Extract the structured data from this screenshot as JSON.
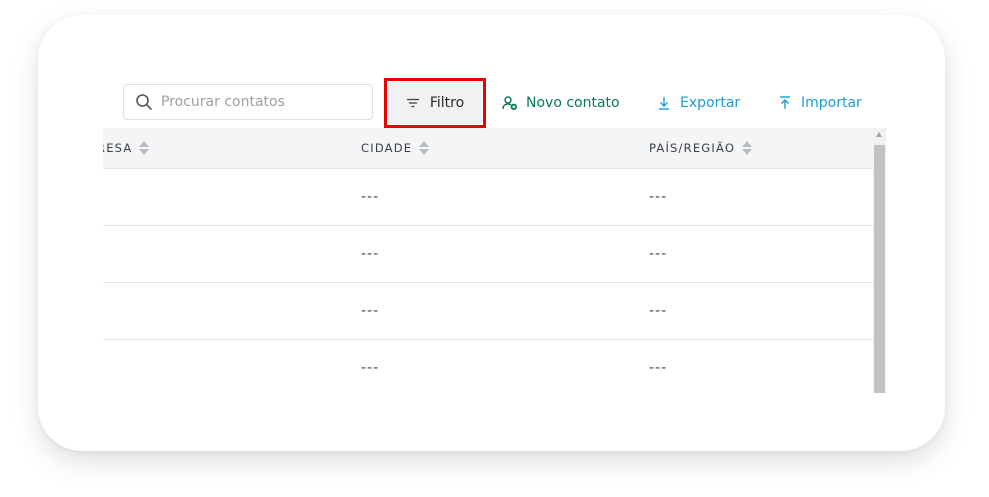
{
  "toolbar": {
    "search_placeholder": "Procurar contatos",
    "filter_label": "Filtro",
    "new_contact_label": "Novo contato",
    "export_label": "Exportar",
    "import_label": "Importar"
  },
  "table": {
    "columns": [
      "RESA",
      "CIDADE",
      "PAÍS/REGIÃO"
    ],
    "rows": [
      {
        "cidade": "---",
        "pais": "---"
      },
      {
        "cidade": "---",
        "pais": "---"
      },
      {
        "cidade": "---",
        "pais": "---"
      },
      {
        "cidade": "---",
        "pais": "---"
      }
    ]
  },
  "colors": {
    "highlight": "#e60000",
    "new_contact": "#0a7a4f",
    "link_blue": "#1a9bd7"
  },
  "icons": {
    "search": "search-icon",
    "filter": "filter-icon",
    "new_contact": "add-user-icon",
    "export": "download-icon",
    "import": "upload-icon"
  }
}
